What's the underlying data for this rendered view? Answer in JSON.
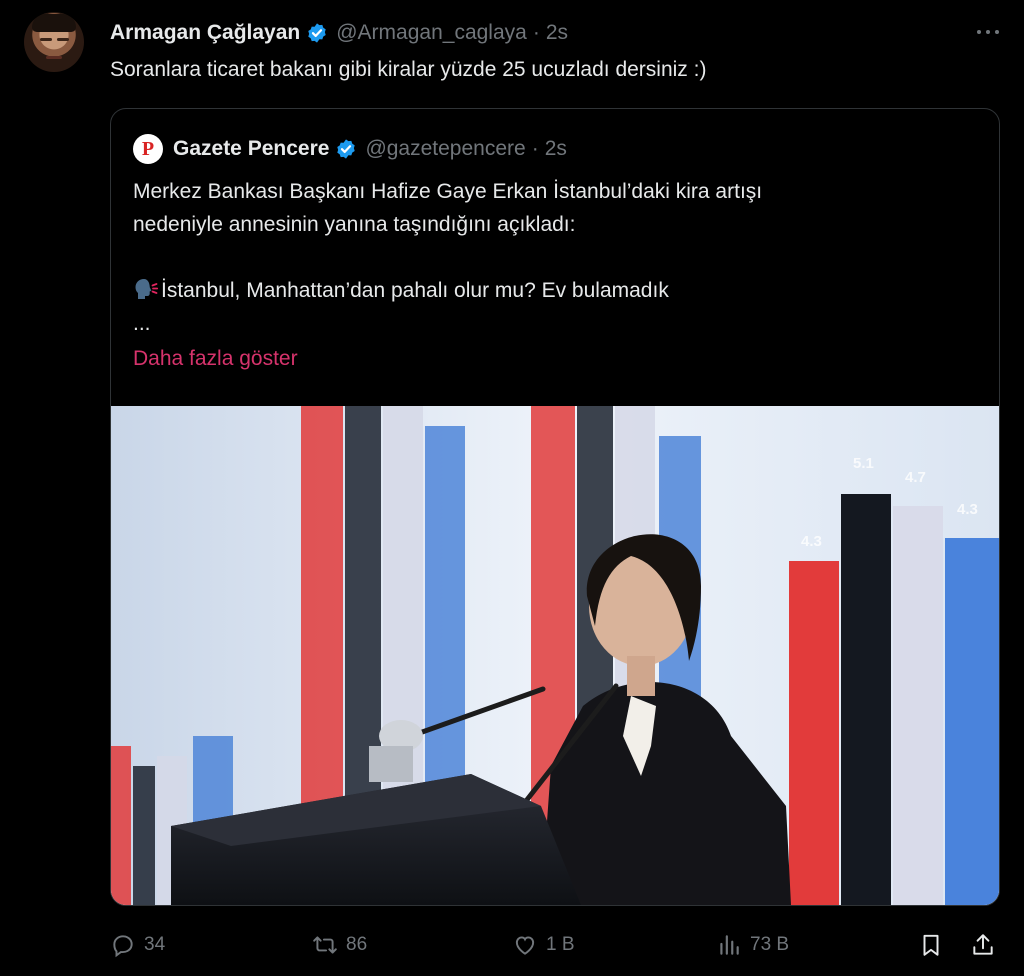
{
  "post": {
    "author_name": "Armagan Çağlayan",
    "author_handle": "@Armagan_caglaya",
    "time": "2s",
    "text": "Soranlara ticaret bakanı gibi kiralar yüzde 25 ucuzladı dersiniz :)"
  },
  "quote": {
    "logo_letter": "P",
    "author_name": "Gazete Pencere",
    "author_handle": "@gazetepencere",
    "time": "2s",
    "line1": "Merkez Bankası Başkanı Hafize Gaye Erkan İstanbul’daki kira artışı",
    "line2": "nedeniyle annesinin yanına taşındığını açıkladı:",
    "line3": "İstanbul, Manhattan’dan pahalı olur mu? Ev bulamadık",
    "line4": "...",
    "show_more": "Daha fazla göster",
    "photo_bar_labels": [
      "4.3",
      "5.1",
      "4.7",
      "4.3"
    ]
  },
  "actions": {
    "replies": "34",
    "reposts": "86",
    "likes": "1 B",
    "views": "73 B"
  },
  "colors": {
    "background": "#000000",
    "text": "#e7e9ea",
    "muted": "#71767b",
    "verified": "#1d9bf0",
    "link": "#d6336c"
  },
  "icons": [
    "verified-badge-icon",
    "more-icon",
    "speaking-head-icon",
    "reply-icon",
    "repost-icon",
    "like-icon",
    "views-icon",
    "bookmark-icon",
    "share-icon"
  ]
}
